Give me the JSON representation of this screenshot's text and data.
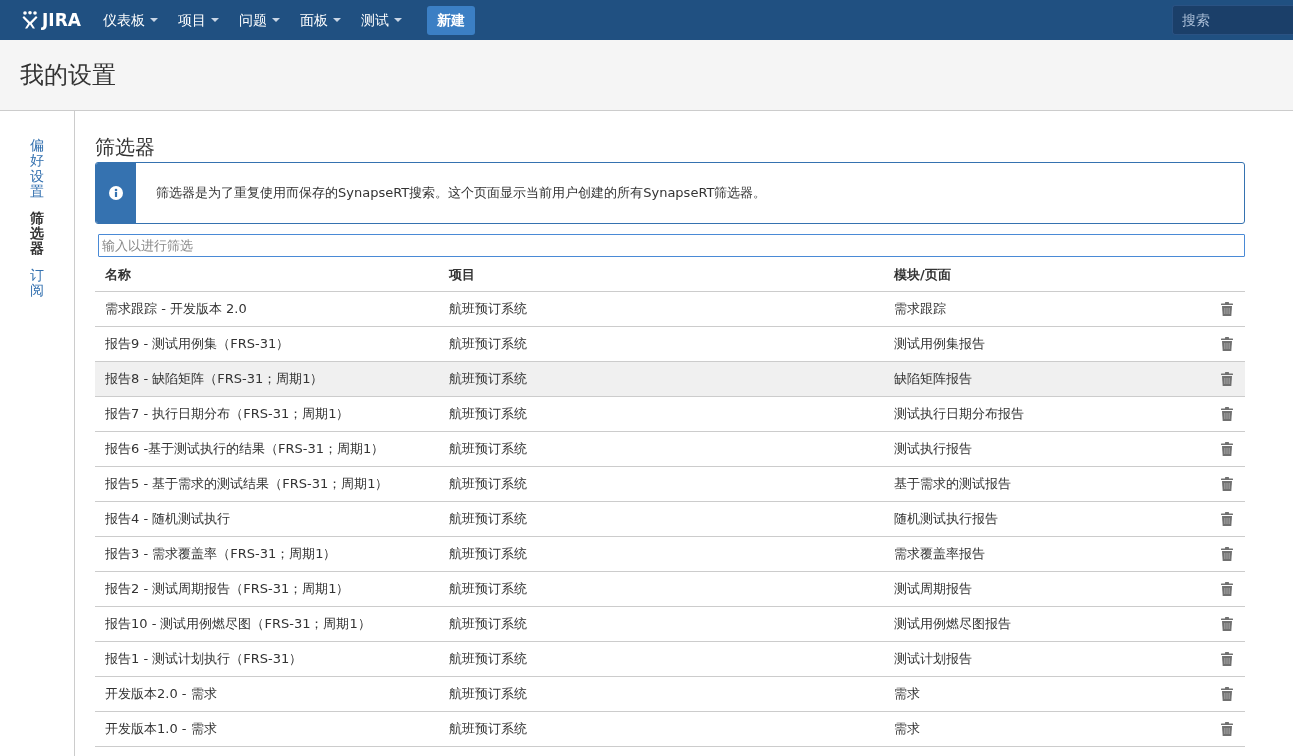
{
  "navbar": {
    "logo": "JIRA",
    "menus": [
      {
        "label": "仪表板"
      },
      {
        "label": "项目"
      },
      {
        "label": "问题"
      },
      {
        "label": "面板"
      },
      {
        "label": "测试"
      }
    ],
    "create_button": "新建",
    "search": {
      "placeholder": "搜索"
    }
  },
  "page_header": {
    "title": "我的设置"
  },
  "sidebar": {
    "items": [
      {
        "label": "偏好设置",
        "selected": false
      },
      {
        "label": "筛选器",
        "selected": true
      },
      {
        "label": "订阅",
        "selected": false
      }
    ]
  },
  "section": {
    "title": "筛选器",
    "info": "筛选器是为了重复使用而保存的SynapseRT搜索。这个页面显示当前用户创建的所有SynapseRT筛选器。",
    "filter": {
      "placeholder": "输入以进行筛选"
    }
  },
  "table": {
    "columns": [
      "名称",
      "项目",
      "模块/页面"
    ],
    "rows": [
      {
        "name": "需求跟踪 - 开发版本 2.0",
        "project": "航班预订系统",
        "module": "需求跟踪",
        "selected": false
      },
      {
        "name": "报告9 - 测试用例集（FRS-31）",
        "project": "航班预订系统",
        "module": "测试用例集报告",
        "selected": false
      },
      {
        "name": "报告8 - 缺陷矩阵（FRS-31；周期1）",
        "project": "航班预订系统",
        "module": "缺陷矩阵报告",
        "selected": true
      },
      {
        "name": "报告7 - 执行日期分布（FRS-31；周期1）",
        "project": "航班预订系统",
        "module": "测试执行日期分布报告",
        "selected": false
      },
      {
        "name": "报告6 -基于测试执行的结果（FRS-31；周期1）",
        "project": "航班预订系统",
        "module": "测试执行报告",
        "selected": false
      },
      {
        "name": "报告5 - 基于需求的测试结果（FRS-31；周期1）",
        "project": "航班预订系统",
        "module": "基于需求的测试报告",
        "selected": false
      },
      {
        "name": "报告4 - 随机测试执行",
        "project": "航班预订系统",
        "module": "随机测试执行报告",
        "selected": false
      },
      {
        "name": "报告3 - 需求覆盖率（FRS-31；周期1）",
        "project": "航班预订系统",
        "module": "需求覆盖率报告",
        "selected": false
      },
      {
        "name": "报告2 - 测试周期报告（FRS-31；周期1）",
        "project": "航班预订系统",
        "module": "测试周期报告",
        "selected": false
      },
      {
        "name": "报告10 - 测试用例燃尽图（FRS-31；周期1）",
        "project": "航班预订系统",
        "module": "测试用例燃尽图报告",
        "selected": false
      },
      {
        "name": "报告1 - 测试计划执行（FRS-31）",
        "project": "航班预订系统",
        "module": "测试计划报告",
        "selected": false
      },
      {
        "name": "开发版本2.0 - 需求",
        "project": "航班预订系统",
        "module": "需求",
        "selected": false
      },
      {
        "name": "开发版本1.0 - 需求",
        "project": "航班预订系统",
        "module": "需求",
        "selected": false
      }
    ]
  }
}
